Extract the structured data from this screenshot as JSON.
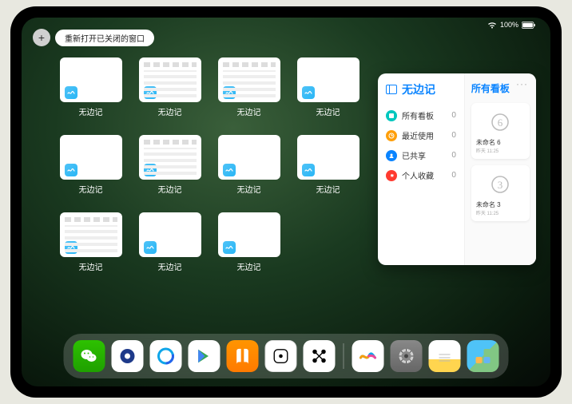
{
  "status": {
    "battery_pct": "100%"
  },
  "pill": {
    "plus": "+",
    "reopen_label": "重新打开已关闭的窗口"
  },
  "app_windows": {
    "label": "无边记",
    "count": 11,
    "detailed_indices": [
      1,
      2,
      5,
      8,
      11
    ]
  },
  "stage": {
    "title": "无边记",
    "ellipsis": "···",
    "sidebar": [
      {
        "label": "所有看板",
        "count": "0",
        "color": "#00c7be"
      },
      {
        "label": "最近使用",
        "count": "0",
        "color": "#ff9f0a"
      },
      {
        "label": "已共享",
        "count": "0",
        "color": "#0a84ff"
      },
      {
        "label": "个人收藏",
        "count": "0",
        "color": "#ff3b30"
      }
    ],
    "right_title": "所有看板",
    "boards": [
      {
        "name": "未命名 6",
        "date": "昨天 11:25",
        "digit": "6"
      },
      {
        "name": "未命名 3",
        "date": "昨天 11:25",
        "digit": "3"
      }
    ]
  },
  "dock": {
    "items": [
      {
        "name": "wechat-icon"
      },
      {
        "name": "quark-icon"
      },
      {
        "name": "qqbrowser-icon"
      },
      {
        "name": "playstore-icon"
      },
      {
        "name": "books-icon"
      },
      {
        "name": "game-icon"
      },
      {
        "name": "nodes-icon"
      }
    ],
    "recents": [
      {
        "name": "freeform-icon"
      },
      {
        "name": "settings-icon"
      },
      {
        "name": "notes-icon"
      },
      {
        "name": "app-library-icon"
      }
    ]
  }
}
